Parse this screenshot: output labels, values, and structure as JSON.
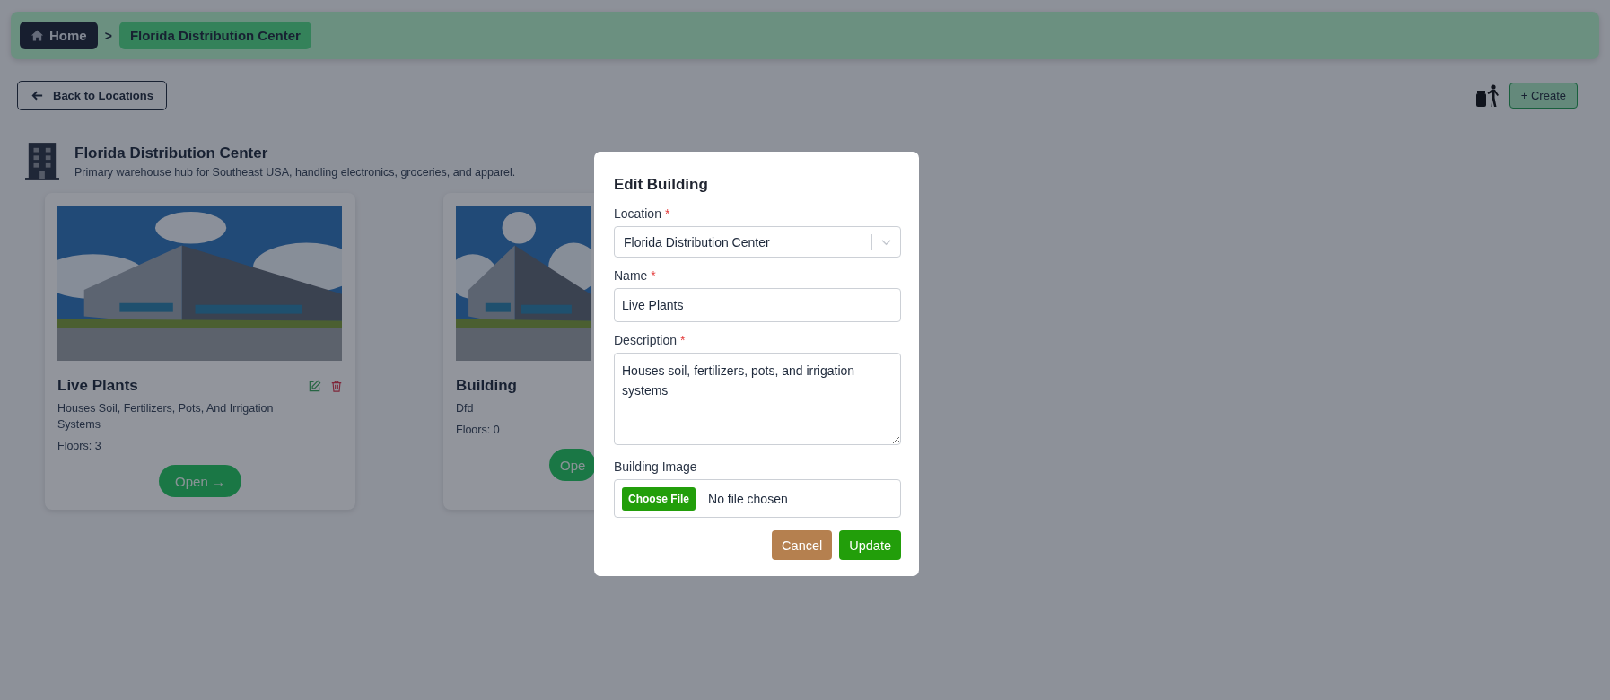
{
  "breadcrumb": [
    {
      "label": "Home",
      "kind": "home"
    },
    {
      "label": "Florida Distribution Center",
      "kind": "current"
    }
  ],
  "separator": ">",
  "back_button": "Back to Locations",
  "create_button": "+ Create",
  "location": {
    "name": "Florida Distribution Center",
    "description": "Primary warehouse hub for Southeast USA, handling electronics, groceries, and apparel."
  },
  "buildings": [
    {
      "name": "Live Plants",
      "description": "Houses Soil, Fertilizers, Pots, And Irrigation Systems",
      "floors": "Floors: 3",
      "open": "Open →",
      "actions": true
    },
    {
      "name": "Building",
      "description": "Dfd",
      "floors": "Floors: 0",
      "open": "Ope",
      "actions": false
    }
  ],
  "modal": {
    "title": "Edit Building",
    "fields": [
      {
        "kind": "select",
        "label": "Location",
        "asterisk": "*",
        "value": "Florida Distribution Center"
      },
      {
        "kind": "text",
        "label": "Name",
        "asterisk": "*",
        "value": "Live Plants"
      },
      {
        "kind": "textarea",
        "label": "Description",
        "asterisk": "*",
        "value": "Houses soil, fertilizers, pots, and irrigation systems"
      },
      {
        "kind": "file",
        "label": "Building Image",
        "button": "Choose File",
        "status": "No file chosen"
      }
    ],
    "buttons": [
      {
        "label": "Cancel",
        "kind": "cancel"
      },
      {
        "label": "Update",
        "kind": "primary"
      }
    ]
  }
}
